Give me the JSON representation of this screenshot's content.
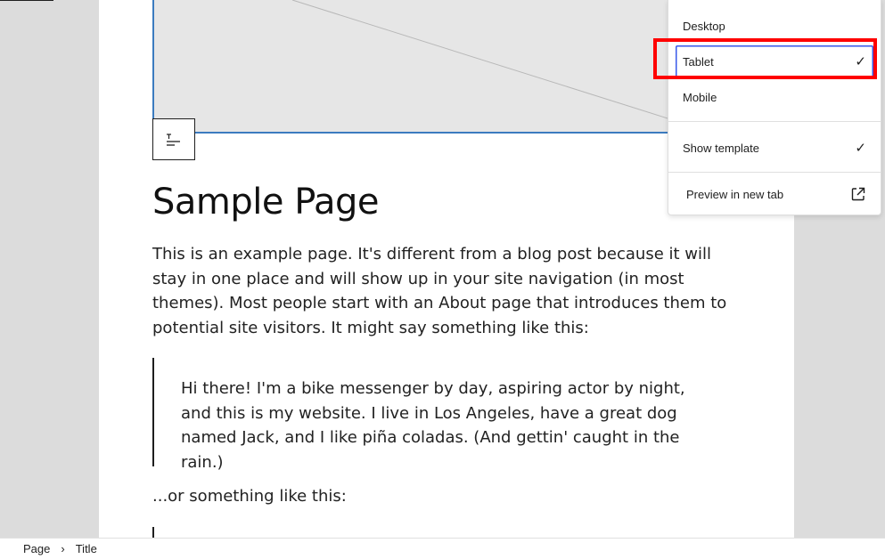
{
  "canvas": {
    "title": "Sample Page",
    "intro": "This is an example page. It's different from a blog post because it will stay in one place and will show up in your site navigation (in most themes). Most people start with an About page that introduces them to potential site visitors. It might say something like this:",
    "quote": "Hi there! I'm a bike messenger by day, aspiring actor by night, and this is my website. I live in Los Angeles, have a great dog named Jack, and I like piña coladas. (And gettin' caught in the rain.)",
    "outro": "...or something like this:",
    "block_toolbar_icon": "align-text-icon"
  },
  "preview_menu": {
    "items": [
      {
        "label": "Desktop",
        "checked": false
      },
      {
        "label": "Tablet",
        "checked": true,
        "check": "✓"
      },
      {
        "label": "Mobile",
        "checked": false
      }
    ],
    "show_template": {
      "label": "Show template",
      "check": "✓"
    },
    "preview_new_tab": {
      "label": "Preview in new tab",
      "icon": "external-link-icon"
    }
  },
  "breadcrumb": {
    "items": [
      "Page",
      "Title"
    ],
    "separator": "›"
  },
  "colors": {
    "highlight": "#ff0000",
    "selection": "#3858e9",
    "image_border": "#3b7bbf"
  }
}
